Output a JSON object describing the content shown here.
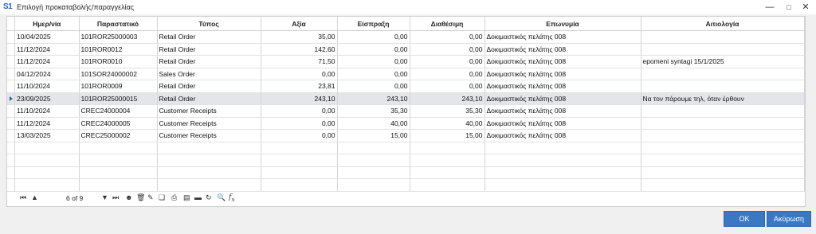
{
  "window": {
    "title": "Επιλογή προκαταβολής/παραγγελίας",
    "logo": "S1"
  },
  "grid": {
    "columns": [
      "Ημερ/νία",
      "Παραστατικό",
      "Τύπος",
      "Αξία",
      "Είσπραξη",
      "Διαθέσιμη",
      "Επωνυμία",
      "Αιτιολογία"
    ],
    "rows": [
      [
        "10/04/2025",
        "101ROR25000003",
        "Retail Order",
        "35,00",
        "0,00",
        "0,00",
        "Δοκιμαστικός πελάτης 008",
        ""
      ],
      [
        "11/12/2024",
        "101ROR0012",
        "Retail Order",
        "142,60",
        "0,00",
        "0,00",
        "Δοκιμαστικός πελάτης 008",
        ""
      ],
      [
        "11/12/2024",
        "101ROR0010",
        "Retail Order",
        "71,50",
        "0,00",
        "0,00",
        "Δοκιμαστικός πελάτης 008",
        "epomeni syntagi 15/1/2025"
      ],
      [
        "04/12/2024",
        "101SOR24000002",
        "Sales Order",
        "0,00",
        "0,00",
        "0,00",
        "Δοκιμαστικός πελάτης 008",
        ""
      ],
      [
        "11/10/2024",
        "101ROR0009",
        "Retail Order",
        "23,81",
        "0,00",
        "0,00",
        "Δοκιμαστικός πελάτης 008",
        ""
      ],
      [
        "23/09/2025",
        "101ROR25000015",
        "Retail Order",
        "243,10",
        "243,10",
        "243,10",
        "Δοκιμαστικός πελάτης 008",
        "Να τον πάρουμε τηλ, όταν έρθουν"
      ],
      [
        "11/10/2024",
        "CREC24000004",
        "Customer Receipts",
        "0,00",
        "35,30",
        "35,30",
        "Δοκιμαστικός πελάτης 008",
        ""
      ],
      [
        "11/12/2024",
        "CREC24000005",
        "Customer Receipts",
        "0,00",
        "40,00",
        "40,00",
        "Δοκιμαστικός πελάτης 008",
        ""
      ],
      [
        "13/03/2025",
        "CREC25000002",
        "Customer Receipts",
        "0,00",
        "15,00",
        "15,00",
        "Δοκιμαστικός πελάτης 008",
        ""
      ]
    ],
    "selected_row": 5,
    "empty_rows": 4
  },
  "navigator": {
    "position": "6 of 9"
  },
  "buttons": {
    "ok": "OK",
    "cancel": "Ακύρωση"
  },
  "colors": {
    "accent": "#3b78c3",
    "selected_row": "#e4e5ea"
  }
}
